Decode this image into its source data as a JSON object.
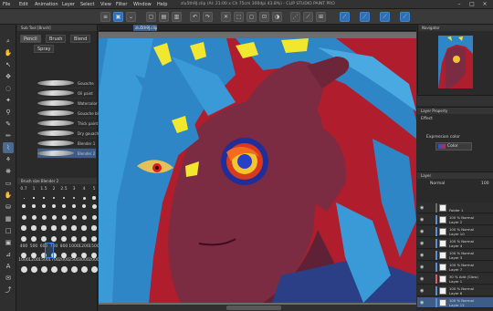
{
  "app": {
    "title": "zlu5th9J.clip (Al: 21:00 x Ch 75cm 300dpi 43.8%) - CLIP STUDIO PAINT PRO",
    "menu": [
      "File",
      "Edit",
      "Animation",
      "Layer",
      "Select",
      "View",
      "Filter",
      "Window",
      "Help"
    ]
  },
  "canvas_tab": "zlu5th9J.clip",
  "subtool": {
    "header": "Sub Tool [Brush]",
    "tabs": [
      "Pencil",
      "Brush",
      "Blend"
    ],
    "tab2": "Spray",
    "brushes": [
      "Gouache",
      "Oil paint",
      "Watercolor",
      "Gouache blend",
      "Thick paint",
      "Dry gouache",
      "Blender 1",
      "Blender 2"
    ],
    "size_header": "Brush size Blender 2",
    "sizes_row1": [
      "0.7",
      "1",
      "1.5",
      "2",
      "2.5",
      "3",
      "4",
      "5"
    ],
    "sizes_row2": [
      "400",
      "500",
      "600",
      "700",
      "800",
      "1000",
      "1200",
      "1500"
    ],
    "sizes_row3": [
      "1000",
      "1200",
      "1500",
      "1700",
      "2000",
      "2500",
      "3000",
      "2000"
    ]
  },
  "navigator": {
    "title": "Navigator"
  },
  "layer_property": {
    "title": "Layer Property",
    "effect_label": "Effect",
    "expression_label": "Expression color",
    "color_value": "Color"
  },
  "layers": {
    "title": "Layer",
    "blend_mode": "Normal",
    "opacity": "100",
    "items": [
      {
        "name": "Folder 1",
        "mode": ""
      },
      {
        "name": "Layer 2",
        "mode": "100 % Normal"
      },
      {
        "name": "Layer 10",
        "mode": "100 % Normal"
      },
      {
        "name": "Layer 4",
        "mode": "100 % Normal"
      },
      {
        "name": "Layer 3",
        "mode": "100 % Normal"
      },
      {
        "name": "Layer 7",
        "mode": "100 % Normal"
      },
      {
        "name": "Layer 1",
        "mode": "30 % Add (Glow)"
      },
      {
        "name": "Layer 6",
        "mode": "100 % Normal"
      },
      {
        "name": "Layer 12",
        "mode": "100 % Normal"
      }
    ]
  },
  "colors": {
    "main": "#1a25d8",
    "sub": "#b01d2c",
    "canvas_bg": "#b01d2c",
    "accent": "#3d5d86"
  }
}
